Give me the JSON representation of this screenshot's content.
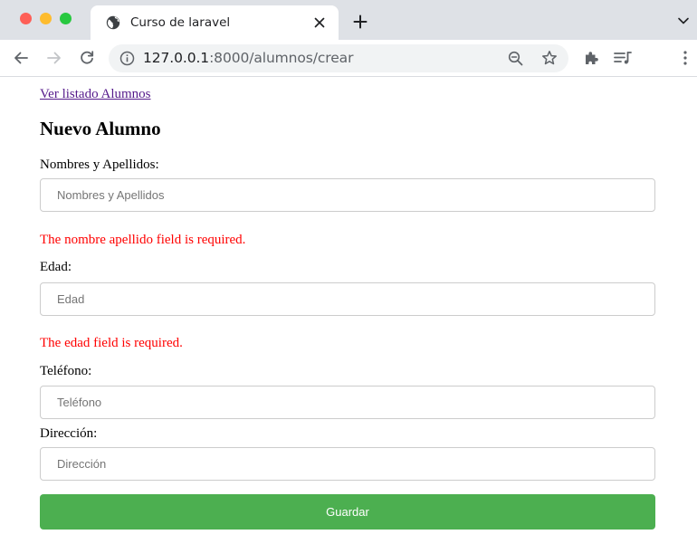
{
  "browser": {
    "tab": {
      "title": "Curso de laravel",
      "favicon": "globe-icon"
    },
    "address": {
      "host": "127.0.0.1",
      "path": ":8000/alumnos/crear"
    }
  },
  "page": {
    "list_link": "Ver listado Alumnos",
    "title": "Nuevo Alumno",
    "fields": [
      {
        "label": "Nombres y Apellidos:",
        "placeholder": "Nombres y Apellidos",
        "value": "",
        "error": "The nombre apellido field is required."
      },
      {
        "label": "Edad:",
        "placeholder": "Edad",
        "value": "",
        "error": "The edad field is required."
      },
      {
        "label": "Teléfono:",
        "placeholder": "Teléfono",
        "value": "",
        "error": ""
      },
      {
        "label": "Dirección:",
        "placeholder": "Dirección",
        "value": "",
        "error": ""
      }
    ],
    "submit_label": "Guardar"
  },
  "colors": {
    "submit": "#4caf50",
    "error": "#ff0000",
    "link_visited": "#551a8b"
  }
}
